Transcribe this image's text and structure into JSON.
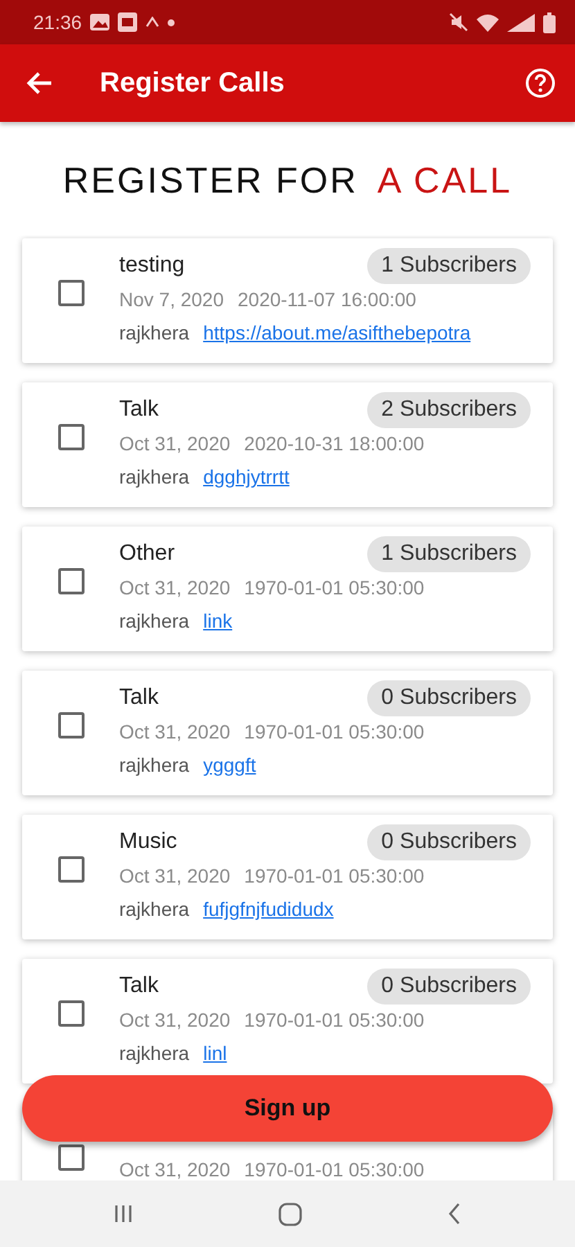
{
  "status_bar": {
    "time": "21:36"
  },
  "app_bar": {
    "title": "Register Calls"
  },
  "heading": {
    "text": "REGISTER FOR",
    "accent": "A CALL"
  },
  "calls": [
    {
      "title": "testing",
      "subscribers": "1 Subscribers",
      "date": "Nov 7, 2020",
      "time": "2020-11-07 16:00:00",
      "user": "rajkhera",
      "link": "https://about.me/asifthebepotra",
      "checked": false
    },
    {
      "title": "Talk",
      "subscribers": "2 Subscribers",
      "date": "Oct 31, 2020",
      "time": "2020-10-31 18:00:00",
      "user": "rajkhera",
      "link": "dgghjytrrtt",
      "checked": false
    },
    {
      "title": "Other",
      "subscribers": "1 Subscribers",
      "date": "Oct 31, 2020",
      "time": "1970-01-01 05:30:00",
      "user": "rajkhera",
      "link": "link",
      "checked": false
    },
    {
      "title": "Talk",
      "subscribers": "0 Subscribers",
      "date": "Oct 31, 2020",
      "time": "1970-01-01 05:30:00",
      "user": "rajkhera",
      "link": "ygggft",
      "checked": false
    },
    {
      "title": "Music",
      "subscribers": "0 Subscribers",
      "date": "Oct 31, 2020",
      "time": "1970-01-01 05:30:00",
      "user": "rajkhera",
      "link": "fufjgfnjfudidudx",
      "checked": false
    },
    {
      "title": "Talk",
      "subscribers": "0 Subscribers",
      "date": "Oct 31, 2020",
      "time": "1970-01-01 05:30:00",
      "user": "rajkhera",
      "link": "linl",
      "checked": false
    },
    {
      "date": "Oct 31, 2020",
      "time": "1970-01-01 05:30:00",
      "checked": false
    }
  ],
  "signup_button": {
    "label": "Sign up"
  }
}
